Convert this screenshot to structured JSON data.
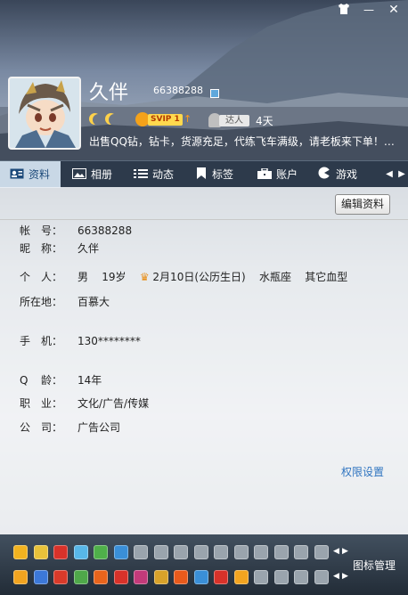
{
  "window": {
    "skin_icon": "tshirt-icon",
    "minimize_icon": "minimize-icon",
    "close_icon": "close-icon",
    "close_glyph": "✕",
    "minimize_glyph": "—"
  },
  "profile": {
    "nickname": "久伴",
    "qq_number": "66388288",
    "svip_label": "SVIP 1",
    "daren_label": "达人",
    "days": "4天",
    "signature": "出售QQ钻，钻卡，货源充足，代练飞车满级，请老板来下单！…"
  },
  "tabs": [
    {
      "label": "资料",
      "icon": "profile-card-icon",
      "active": true
    },
    {
      "label": "相册",
      "icon": "album-icon",
      "active": false
    },
    {
      "label": "动态",
      "icon": "feed-icon",
      "active": false
    },
    {
      "label": "标签",
      "icon": "bookmark-icon",
      "active": false
    },
    {
      "label": "账户",
      "icon": "briefcase-icon",
      "active": false
    },
    {
      "label": "游戏",
      "icon": "game-icon",
      "active": false
    }
  ],
  "edit_button": "编辑资料",
  "fields": {
    "account": {
      "label_a": "帐",
      "label_b": "号：",
      "value": "66388288"
    },
    "nick": {
      "label_a": "昵",
      "label_b": "称：",
      "value": "久伴"
    },
    "personal": {
      "label_a": "个",
      "label_b": "人：",
      "gender": "男",
      "age": "19岁",
      "birthday": "2月10日(公历生日)",
      "zodiac": "水瓶座",
      "blood": "其它血型"
    },
    "location": {
      "label": "所在地：",
      "value": "百慕大"
    },
    "phone": {
      "label_a": "手",
      "label_b": "机：",
      "value": "130********"
    },
    "qage": {
      "label_a": "Q",
      "label_b": "龄：",
      "value": "14年"
    },
    "job": {
      "label_a": "职",
      "label_b": "业：",
      "value": "文化/广告/传媒"
    },
    "company": {
      "label_a": "公",
      "label_b": "司：",
      "value": "广告公司"
    }
  },
  "permission_link": "权限设置",
  "icon_manager": "图标管理"
}
